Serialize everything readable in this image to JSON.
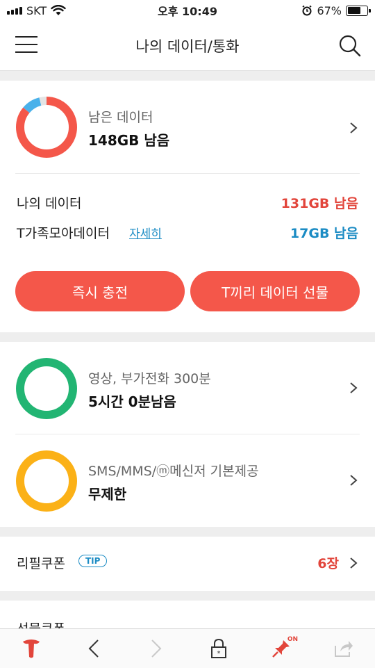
{
  "status_bar": {
    "carrier": "SKT",
    "time": "오후 10:49",
    "battery_percent": "67%",
    "battery_level": 0.67
  },
  "header": {
    "title": "나의 데이터/통화"
  },
  "data_card": {
    "title": "남은 데이터",
    "value": "148GB 남음",
    "ring": {
      "red_fraction": 0.86,
      "blue_fraction": 0.1,
      "grey_fraction": 0.04,
      "red_color": "#f4574a",
      "blue_color": "#4ab1ea",
      "grey_color": "#e4e4e4"
    },
    "my_data_label": "나의 데이터",
    "my_data_value": "131GB 남음",
    "my_data_color": "#e2453b",
    "family_label": "T가족모아데이터",
    "family_detail_link": "자세히",
    "family_value": "17GB 남음",
    "family_color": "#1c8cc4",
    "charge_button": "즉시 충전",
    "gift_button": "T끼리 데이터 선물"
  },
  "voice_card": {
    "title": "영상, 부가전화 300분",
    "value": "5시간 0분남음",
    "ring_color": "#22b573"
  },
  "sms_card": {
    "title": "SMS/MMS/ⓜ메신저 기본제공",
    "value": "무제한",
    "ring_color": "#fbb117"
  },
  "refill_coupon": {
    "label": "리필쿠폰",
    "tip_badge": "TIP",
    "count": "6장"
  },
  "partial_section": {
    "label": "선물쿠폰"
  },
  "toolbar": {
    "items": [
      "t-logo-icon",
      "back-icon",
      "forward-icon",
      "lock-icon",
      "pin-icon",
      "share-icon"
    ],
    "pin_state": "ON"
  }
}
